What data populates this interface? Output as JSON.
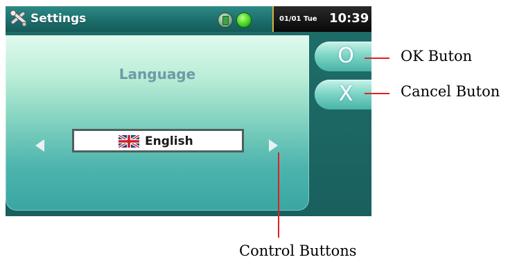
{
  "title_bar": {
    "title": "Settings",
    "app_icon": "tools-icon",
    "status_icons": [
      "battery-icon",
      "signal-icon"
    ],
    "date": "01/01 Tue",
    "time": "10:39"
  },
  "panel": {
    "heading": "Language",
    "selected_language": "English",
    "flag_icon": "uk-flag-icon",
    "prev_icon": "triangle-left-icon",
    "next_icon": "triangle-right-icon"
  },
  "buttons": {
    "ok_glyph": "O",
    "cancel_glyph": "X"
  },
  "annotations": {
    "ok": "OK Buton",
    "cancel": "Cancel Buton",
    "controls": "Control Buttons"
  },
  "colors": {
    "callout_line": "#e02020",
    "accent_teal": "#2d8a86"
  }
}
